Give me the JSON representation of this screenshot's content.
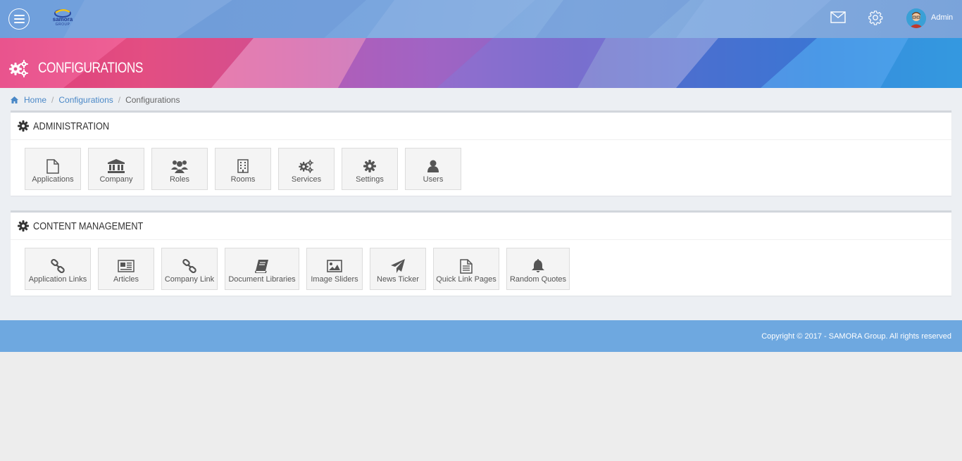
{
  "topnav": {
    "logo_text": "samora",
    "logo_sub": "GROUP",
    "user_name": "Admin"
  },
  "banner": {
    "title": "Configurations"
  },
  "breadcrumb": {
    "home": "Home",
    "parent": "Configurations",
    "current": "Configurations"
  },
  "administration": {
    "title": "Administration",
    "tiles": [
      {
        "label": "Applications",
        "icon": "file-icon"
      },
      {
        "label": "Company",
        "icon": "bank-icon"
      },
      {
        "label": "Roles",
        "icon": "users-group-icon"
      },
      {
        "label": "Rooms",
        "icon": "building-icon"
      },
      {
        "label": "Services",
        "icon": "cogs-icon"
      },
      {
        "label": "Settings",
        "icon": "gear-icon"
      },
      {
        "label": "Users",
        "icon": "user-icon"
      }
    ]
  },
  "content_management": {
    "title": "Content Management",
    "tiles": [
      {
        "label": "Application Links",
        "icon": "link-icon"
      },
      {
        "label": "Articles",
        "icon": "newspaper-icon"
      },
      {
        "label": "Company Link",
        "icon": "link-icon"
      },
      {
        "label": "Document Libraries",
        "icon": "book-icon"
      },
      {
        "label": "Image Sliders",
        "icon": "image-icon"
      },
      {
        "label": "News Ticker",
        "icon": "paper-plane-icon"
      },
      {
        "label": "Quick Link Pages",
        "icon": "file-text-icon"
      },
      {
        "label": "Random Quotes",
        "icon": "bell-icon"
      }
    ]
  },
  "footer": {
    "copyright": "Copyright © 2017 - SAMORA Group. All rights reserved"
  }
}
